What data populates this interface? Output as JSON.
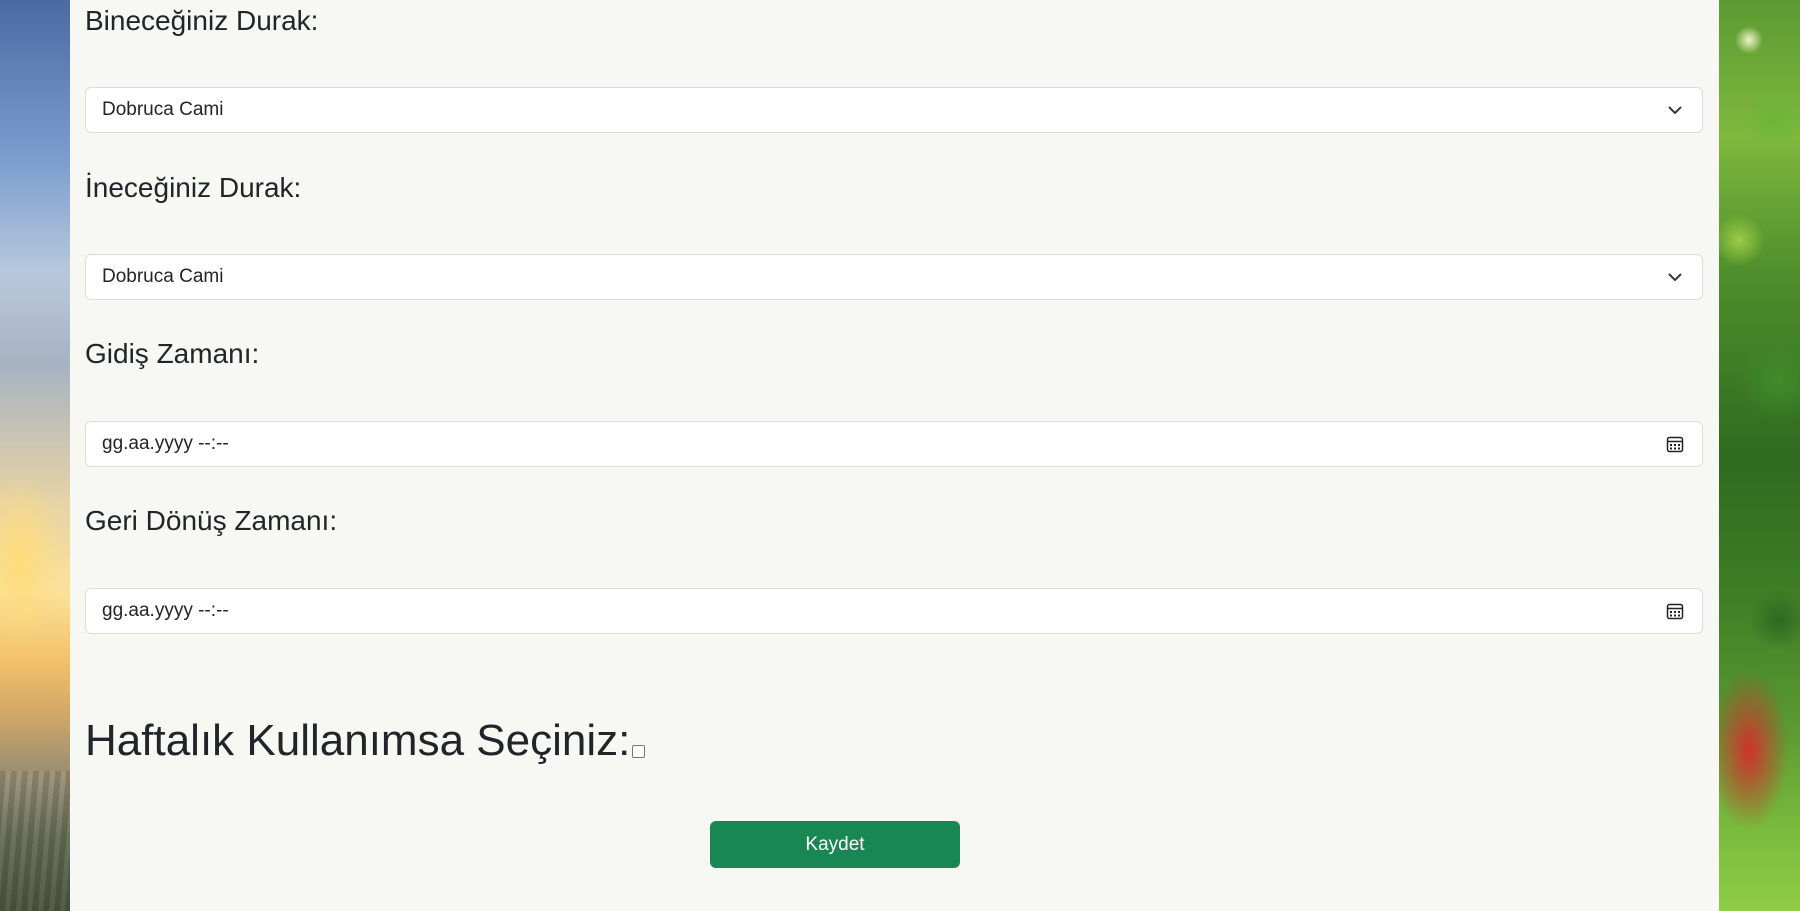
{
  "form": {
    "boarding_stop_label": "Bineceğiniz Durak:",
    "boarding_stop_value": "Dobruca Cami",
    "alighting_stop_label": "İneceğiniz Durak:",
    "alighting_stop_value": "Dobruca Cami",
    "departure_time_label": "Gidiş Zamanı:",
    "departure_time_placeholder": "gg.aa.yyyy --:--",
    "return_time_label": "Geri Dönüş Zamanı:",
    "return_time_placeholder": "gg.aa.yyyy --:--",
    "weekly_usage_label": "Haftalık Kullanımsa Seçiniz:",
    "weekly_usage_checked": false,
    "save_label": "Kaydet"
  },
  "icons": {
    "select_arrow": "chevron-down-icon",
    "date_picker": "calendar-icon"
  },
  "colors": {
    "panel_background": "#f7f7f3",
    "save_button": "#198754",
    "text": "#212529"
  }
}
